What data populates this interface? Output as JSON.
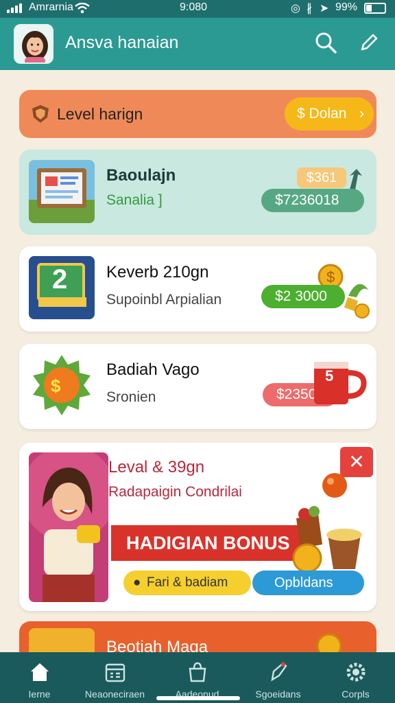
{
  "status_bar": {
    "carrier": "Amrarnia",
    "time": "9:080",
    "battery": "99%"
  },
  "app_bar": {
    "title": "Ansva hanaian"
  },
  "level_bar": {
    "label": "Level harign",
    "button_label": "$ Dolan"
  },
  "cards": [
    {
      "title": "Baoulajn",
      "subtitle": "Sanalia ]",
      "tag": "$361",
      "amount": "$7236018"
    },
    {
      "title": "Keverb 210gn",
      "subtitle": "Supoinbl Arpialian",
      "thumb_number": "2",
      "amount": "$2 3000"
    },
    {
      "title": "Badiah Vago",
      "subtitle": "Sronien",
      "mug_number": "5",
      "amount": "$2350"
    }
  ],
  "promo": {
    "title": "Leval & 39gn",
    "subtitle": "Radapaigin Condrilai",
    "banner": "HADIGIAN BONUS",
    "left_pill": "Fari & badiam",
    "right_pill": "Opbldans"
  },
  "bottom_card": {
    "title": "Beotiah Maga"
  },
  "nav": [
    {
      "label": "Ierne",
      "icon": "home-icon"
    },
    {
      "label": "Neaoneciraen",
      "icon": "calendar-icon"
    },
    {
      "label": "Aadeonud",
      "icon": "bag-icon"
    },
    {
      "label": "Sgoeidans",
      "icon": "rocket-icon"
    },
    {
      "label": "Corpls",
      "icon": "settings-icon"
    }
  ],
  "colors": {
    "teal": "#2a9a93",
    "nav": "#1a5a5c",
    "orange": "#ef8a58",
    "green": "#4caf2f",
    "yellow": "#f6b818",
    "red": "#d9322a"
  }
}
